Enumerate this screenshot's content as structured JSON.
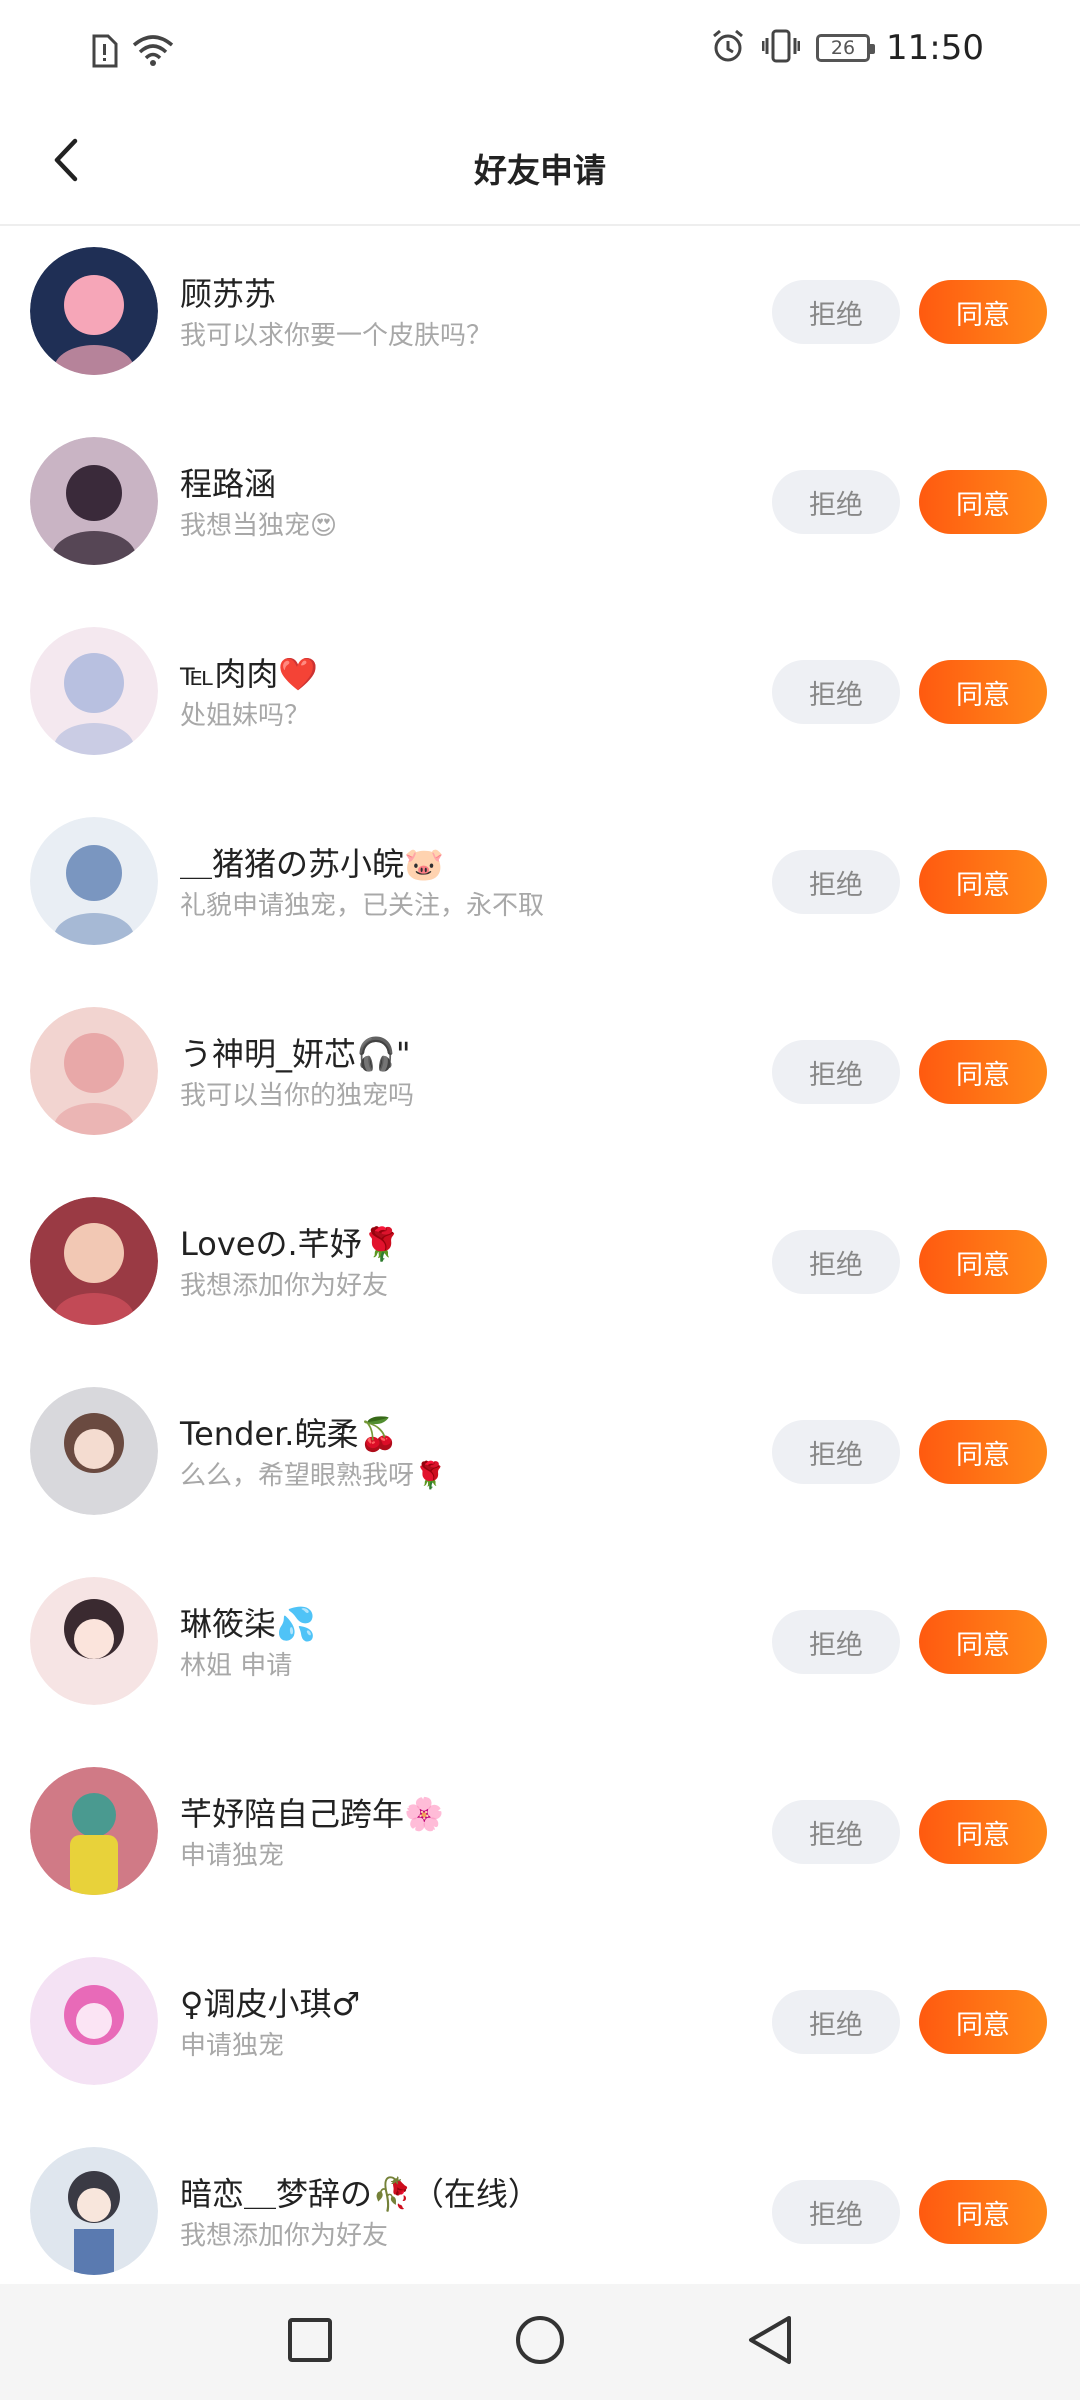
{
  "status_bar": {
    "battery": "26",
    "time": "11:50",
    "icons": [
      "sim-alert-icon",
      "wifi-icon",
      "alarm-icon",
      "vibrate-icon",
      "battery-icon"
    ]
  },
  "header": {
    "title": "好友申请",
    "back_icon": "back-arrow-icon"
  },
  "requests": [
    {
      "name": "顾苏苏",
      "message": "我可以求你要一个皮肤吗？",
      "avatar_colors": [
        "#1f2f55",
        "#f6a6b8"
      ],
      "reject_label": "拒绝",
      "accept_label": "同意"
    },
    {
      "name": "程路涵",
      "message": "我想当独宠😍",
      "avatar_colors": [
        "#3a2a3a",
        "#c9b4c4"
      ],
      "reject_label": "拒绝",
      "accept_label": "同意"
    },
    {
      "name": "℡肉肉❤️",
      "message": "处姐妹吗？",
      "avatar_colors": [
        "#b8c0e0",
        "#f4e8ef"
      ],
      "reject_label": "拒绝",
      "accept_label": "同意"
    },
    {
      "name": "＿猪猪の苏小皖🐷",
      "message": "礼貌申请独宠，已关注，永不取",
      "avatar_colors": [
        "#e9eef4",
        "#7a96c0"
      ],
      "reject_label": "拒绝",
      "accept_label": "同意"
    },
    {
      "name": "う神明_妍芯🎧\"",
      "message": "我可以当你的独宠吗",
      "avatar_colors": [
        "#f2d4d0",
        "#e8a8a8"
      ],
      "reject_label": "拒绝",
      "accept_label": "同意"
    },
    {
      "name": "Loveの.芊妤🌹",
      "message": "我想添加你为好友",
      "avatar_colors": [
        "#9a3a44",
        "#f2c8b4"
      ],
      "reject_label": "拒绝",
      "accept_label": "同意"
    },
    {
      "name": "Tender.皖柔🍒",
      "message": "么么，希望眼熟我呀🌹",
      "avatar_colors": [
        "#d8d8dc",
        "#6a4a40"
      ],
      "reject_label": "拒绝",
      "accept_label": "同意"
    },
    {
      "name": "琳筱柒💦",
      "message": "林姐  申请",
      "avatar_colors": [
        "#f6e4e4",
        "#3a2a30"
      ],
      "reject_label": "拒绝",
      "accept_label": "同意"
    },
    {
      "name": "芊妤陪自己跨年🌸",
      "message": "申请独宠",
      "avatar_colors": [
        "#d07a86",
        "#e8d23a"
      ],
      "reject_label": "拒绝",
      "accept_label": "同意"
    },
    {
      "name": "♀调皮小琪♂",
      "message": "申请独宠",
      "avatar_colors": [
        "#f4e2f4",
        "#e86ab8"
      ],
      "reject_label": "拒绝",
      "accept_label": "同意"
    },
    {
      "name": "暗恋＿梦辞の🥀（在线）",
      "message": "我想添加你为好友",
      "avatar_colors": [
        "#dfe6ee",
        "#3a3a44"
      ],
      "reject_label": "拒绝",
      "accept_label": "同意"
    }
  ],
  "nav_bar": {
    "icons": [
      "recents-square-icon",
      "home-circle-icon",
      "back-triangle-icon"
    ]
  },
  "colors": {
    "accept_gradient_start": "#ff5a10",
    "accept_gradient_end": "#ff8a1a",
    "reject_bg": "#eef0f4",
    "message_text": "#a8a8a8"
  }
}
